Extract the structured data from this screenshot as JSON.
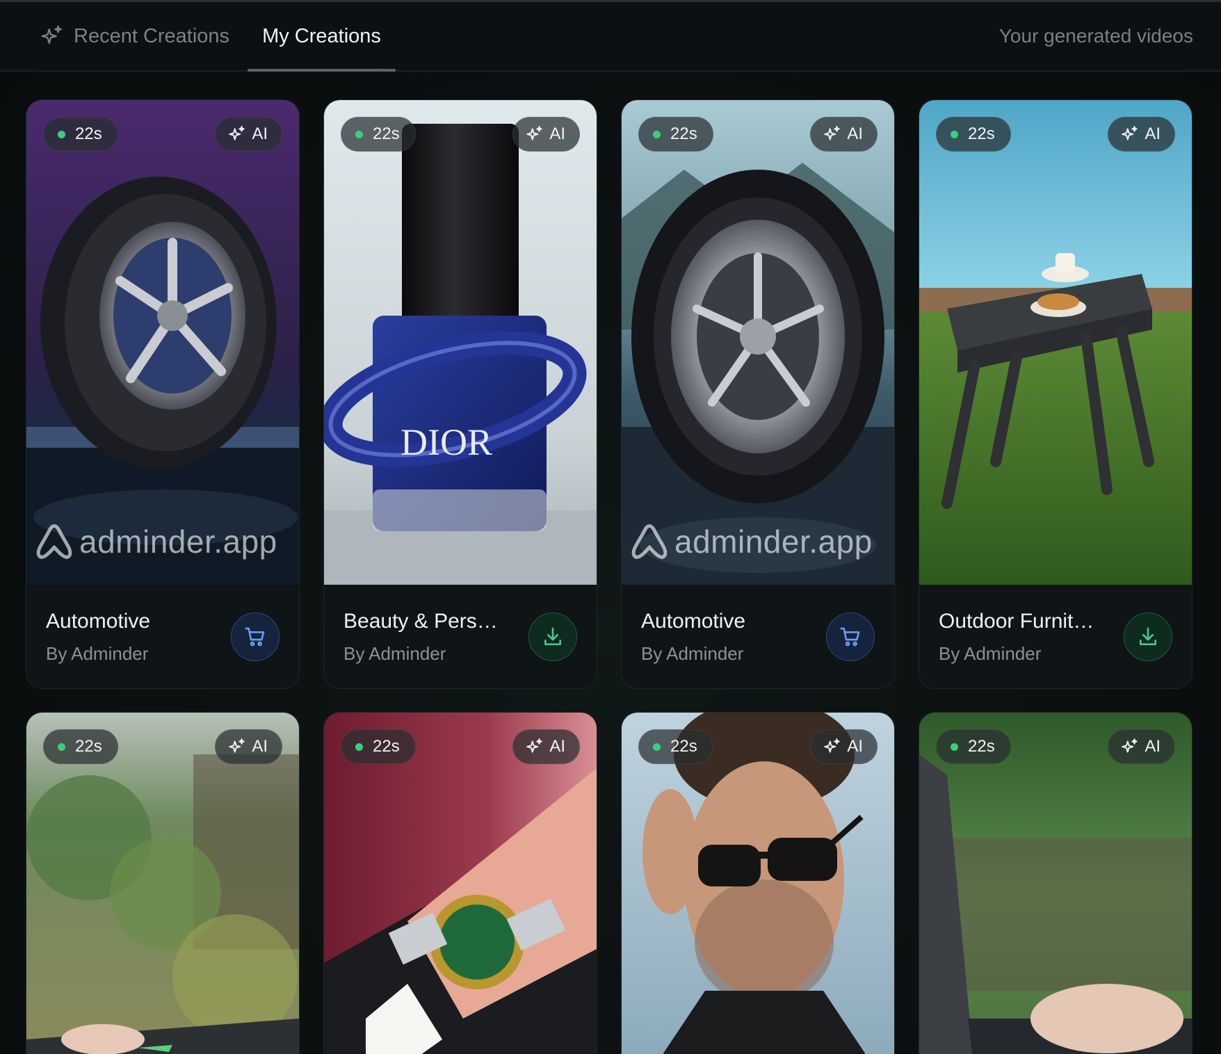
{
  "header": {
    "tabs": [
      {
        "label": "Recent Creations",
        "icon": "sparkles-icon",
        "active": false
      },
      {
        "label": "My Creations",
        "active": true
      }
    ],
    "subtitle": "Your generated videos"
  },
  "colors": {
    "background": "#0b0f0f",
    "duration_dot": "#3ad07a",
    "cart_button": "#15233d",
    "download_button": "#0f2a1f"
  },
  "cards": [
    {
      "duration": "22s",
      "ai_label": "AI",
      "title": "Automotive",
      "author": "By Adminder",
      "action": "cart",
      "watermark": "adminder.app",
      "thumbnail": "tire on wet surface, purple background"
    },
    {
      "duration": "22s",
      "ai_label": "AI",
      "title": "Beauty & Pers…",
      "author": "By Adminder",
      "action": "download",
      "thumbnail": "blue nail polish bottle"
    },
    {
      "duration": "22s",
      "ai_label": "AI",
      "title": "Automotive",
      "author": "By Adminder",
      "action": "cart",
      "watermark": "adminder.app",
      "thumbnail": "tire with mountains"
    },
    {
      "duration": "22s",
      "ai_label": "AI",
      "title": "Outdoor Furnit…",
      "author": "By Adminder",
      "action": "download",
      "thumbnail": "table by pool on grass"
    },
    {
      "duration": "22s",
      "ai_label": "AI",
      "thumbnail": "garden with laptop"
    },
    {
      "duration": "22s",
      "ai_label": "AI",
      "thumbnail": "wrist watch green dial"
    },
    {
      "duration": "22s",
      "ai_label": "AI",
      "thumbnail": "man with sunglasses"
    },
    {
      "duration": "22s",
      "ai_label": "AI",
      "thumbnail": "laptop outdoors"
    }
  ]
}
